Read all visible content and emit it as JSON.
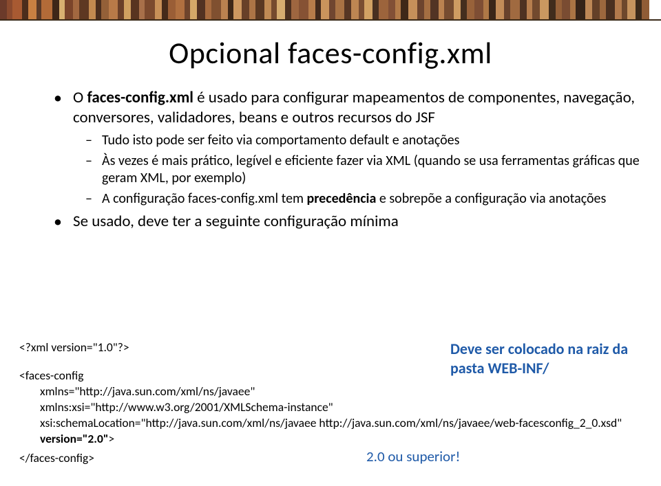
{
  "title": "Opcional faces-config.xml",
  "bullets": {
    "b1_pre": "O ",
    "b1_bold": "faces-config.xml",
    "b1_post": " é usado para configurar mapeamentos de componentes, navegação, conversores, validadores, beans e outros recursos do JSF",
    "b1_sub1": "Tudo isto pode ser feito via comportamento default e anotações",
    "b1_sub2": "Às vezes é mais prático, legível e eficiente fazer via XML (quando se usa ferramentas gráficas que geram XML, por exemplo)",
    "b1_sub3_pre": "A configuração faces-config.xml tem ",
    "b1_sub3_bold": "precedência",
    "b1_sub3_post": " e sobrepõe a configuração via anotações",
    "b2": "Se usado, deve ter a seguinte configuração mínima"
  },
  "code": {
    "l1": "<?xml version=\"1.0\"?>",
    "l2": "<faces-config",
    "l3": "xmlns=\"http://java.sun.com/xml/ns/javaee\"",
    "l4": "xmlns:xsi=\"http://www.w3.org/2001/XMLSchema-instance\"",
    "l5": "xsi:schemaLocation=\"http://java.sun.com/xml/ns/javaee  http://java.sun.com/xml/ns/javaee/web-facesconfig_2_0.xsd\"",
    "l6_bold": "version=\"2.0\"",
    "l6_post": ">",
    "close": "</faces-config>"
  },
  "callout": "Deve ser colocado na raiz da pasta WEB-INF/",
  "footer": "2.0 ou superior!",
  "books": [
    {
      "w": 10,
      "c": "#6b3a2a"
    },
    {
      "w": 8,
      "c": "#8a4a2e"
    },
    {
      "w": 14,
      "c": "#a85a32"
    },
    {
      "w": 9,
      "c": "#4b2d1c"
    },
    {
      "w": 12,
      "c": "#c98042"
    },
    {
      "w": 7,
      "c": "#5a3a28"
    },
    {
      "w": 16,
      "c": "#b36b38"
    },
    {
      "w": 10,
      "c": "#3d2618"
    },
    {
      "w": 8,
      "c": "#d8b070"
    },
    {
      "w": 12,
      "c": "#7a442a"
    },
    {
      "w": 9,
      "c": "#a26840"
    },
    {
      "w": 14,
      "c": "#5e3822"
    },
    {
      "w": 10,
      "c": "#c28a50"
    },
    {
      "w": 8,
      "c": "#4a2e1e"
    },
    {
      "w": 11,
      "c": "#946038"
    },
    {
      "w": 13,
      "c": "#b87a48"
    },
    {
      "w": 9,
      "c": "#6a3f28"
    },
    {
      "w": 10,
      "c": "#d0a060"
    },
    {
      "w": 12,
      "c": "#583420"
    },
    {
      "w": 8,
      "c": "#a8704a"
    },
    {
      "w": 15,
      "c": "#7c4a2e"
    },
    {
      "w": 10,
      "c": "#c89058"
    },
    {
      "w": 9,
      "c": "#452a1a"
    },
    {
      "w": 11,
      "c": "#9a5e36"
    },
    {
      "w": 13,
      "c": "#b07040"
    },
    {
      "w": 8,
      "c": "#6e442c"
    },
    {
      "w": 10,
      "c": "#d4a868"
    },
    {
      "w": 12,
      "c": "#523222"
    },
    {
      "w": 9,
      "c": "#a66a3e"
    },
    {
      "w": 14,
      "c": "#805030"
    },
    {
      "w": 10,
      "c": "#ba8250"
    },
    {
      "w": 8,
      "c": "#3f2818"
    },
    {
      "w": 12,
      "c": "#ce9860"
    },
    {
      "w": 11,
      "c": "#684028"
    },
    {
      "w": 9,
      "c": "#ac7446"
    },
    {
      "w": 13,
      "c": "#5a3822"
    },
    {
      "w": 10,
      "c": "#c08a54"
    },
    {
      "w": 8,
      "c": "#764a2e"
    },
    {
      "w": 12,
      "c": "#d6ac70"
    },
    {
      "w": 9,
      "c": "#4c3020"
    },
    {
      "w": 11,
      "c": "#9e6640"
    },
    {
      "w": 14,
      "c": "#865234"
    },
    {
      "w": 10,
      "c": "#b67c4a"
    },
    {
      "w": 8,
      "c": "#422a1c"
    },
    {
      "w": 12,
      "c": "#ca945c"
    },
    {
      "w": 9,
      "c": "#704630"
    },
    {
      "w": 13,
      "c": "#a87244"
    },
    {
      "w": 10,
      "c": "#563624"
    },
    {
      "w": 11,
      "c": "#be8652"
    },
    {
      "w": 8,
      "c": "#7a4e32"
    },
    {
      "w": 12,
      "c": "#d2a264"
    },
    {
      "w": 9,
      "c": "#483020"
    },
    {
      "w": 14,
      "c": "#9c643c"
    },
    {
      "w": 10,
      "c": "#825036"
    },
    {
      "w": 8,
      "c": "#b27a48"
    },
    {
      "w": 11,
      "c": "#3e2818"
    },
    {
      "w": 13,
      "c": "#c6905a"
    },
    {
      "w": 10,
      "c": "#6c442e"
    },
    {
      "w": 9,
      "c": "#a46e42"
    },
    {
      "w": 12,
      "c": "#523424"
    },
    {
      "w": 8,
      "c": "#ba8250"
    },
    {
      "w": 14,
      "c": "#764c30"
    },
    {
      "w": 10,
      "c": "#ce9c62"
    },
    {
      "w": 9,
      "c": "#442e1e"
    },
    {
      "w": 11,
      "c": "#98623a"
    },
    {
      "w": 13,
      "c": "#7e4e34"
    },
    {
      "w": 8,
      "c": "#ae7846"
    },
    {
      "w": 10,
      "c": "#3a2618"
    },
    {
      "w": 12,
      "c": "#c28c58"
    },
    {
      "w": 9,
      "c": "#68422c"
    },
    {
      "w": 14,
      "c": "#a06a40"
    },
    {
      "w": 10,
      "c": "#4e3222"
    },
    {
      "w": 8,
      "c": "#b67e4e"
    },
    {
      "w": 11,
      "c": "#724a2e"
    },
    {
      "w": 13,
      "c": "#ca9860"
    },
    {
      "w": 10,
      "c": "#402c1c"
    },
    {
      "w": 9,
      "c": "#946038"
    },
    {
      "w": 12,
      "c": "#7a4c32"
    },
    {
      "w": 8,
      "c": "#aa7444"
    },
    {
      "w": 14,
      "c": "#362418"
    },
    {
      "w": 10,
      "c": "#be8856"
    },
    {
      "w": 11,
      "c": "#644028"
    },
    {
      "w": 9,
      "c": "#9c683e"
    },
    {
      "w": 13,
      "c": "#4a3020"
    },
    {
      "w": 10,
      "c": "#b27a4c"
    },
    {
      "w": 8,
      "c": "#6e482c"
    },
    {
      "w": 12,
      "c": "#c6945e"
    },
    {
      "w": 9,
      "c": "#3c2a1a"
    },
    {
      "w": 11,
      "c": "#905c36"
    }
  ]
}
